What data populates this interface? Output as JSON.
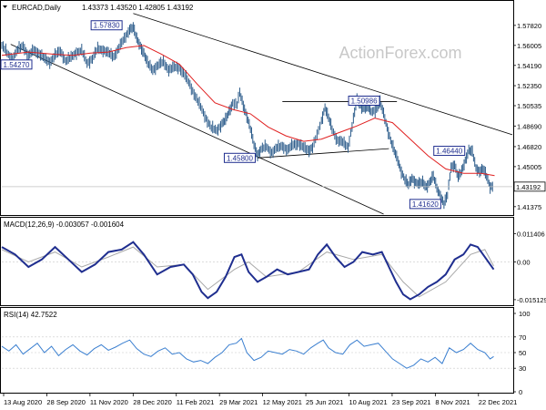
{
  "header": {
    "symbol": "EURCAD,Daily",
    "ohlc": "1.43373 1.43520 1.42805 1.43192"
  },
  "watermark": "ActionForex.com",
  "colors": {
    "price": "#2b5b8a",
    "ma": "#e02020",
    "channel": "#000000",
    "macd": "#1f2e8f",
    "signal": "#a8a8a8",
    "rsi": "#3a7fd0",
    "label": "#1f2e8f"
  },
  "chart_data": [
    {
      "type": "line",
      "title": "EURCAD,Daily",
      "ylim": [
        1.407,
        1.588
      ],
      "y_ticks": [
        "1.57820",
        "1.56005",
        "1.54190",
        "1.52350",
        "1.50535",
        "1.48690",
        "1.46820",
        "1.45005",
        "1.43192",
        "1.41375"
      ],
      "x_ticks": [
        "13 Aug 2020",
        "28 Sep 2020",
        "11 Nov 2020",
        "28 Dec 2020",
        "11 Feb 2021",
        "29 Mar 2021",
        "12 May 2021",
        "25 Jun 2021",
        "10 Aug 2021",
        "23 Sep 2021",
        "8 Nov 2021",
        "22 Dec 2021"
      ],
      "current_price": "1.43192",
      "price_path": [
        [
          0,
          1.56
        ],
        [
          6,
          1.553
        ],
        [
          12,
          1.548
        ],
        [
          18,
          1.556
        ],
        [
          24,
          1.56
        ],
        [
          30,
          1.55
        ],
        [
          36,
          1.556
        ],
        [
          42,
          1.553
        ],
        [
          48,
          1.548
        ],
        [
          54,
          1.545
        ],
        [
          60,
          1.551
        ],
        [
          66,
          1.555
        ],
        [
          72,
          1.546
        ],
        [
          78,
          1.549
        ],
        [
          84,
          1.554
        ],
        [
          90,
          1.555
        ],
        [
          96,
          1.544
        ],
        [
          102,
          1.548
        ],
        [
          108,
          1.557
        ],
        [
          114,
          1.556
        ],
        [
          120,
          1.553
        ],
        [
          126,
          1.55
        ],
        [
          132,
          1.558
        ],
        [
          138,
          1.566
        ],
        [
          144,
          1.575
        ],
        [
          148,
          1.576
        ],
        [
          152,
          1.566
        ],
        [
          156,
          1.56
        ],
        [
          160,
          1.553
        ],
        [
          164,
          1.544
        ],
        [
          170,
          1.538
        ],
        [
          176,
          1.542
        ],
        [
          182,
          1.545
        ],
        [
          188,
          1.538
        ],
        [
          194,
          1.54
        ],
        [
          200,
          1.54
        ],
        [
          206,
          1.533
        ],
        [
          212,
          1.524
        ],
        [
          218,
          1.514
        ],
        [
          224,
          1.504
        ],
        [
          230,
          1.494
        ],
        [
          236,
          1.485
        ],
        [
          242,
          1.483
        ],
        [
          248,
          1.489
        ],
        [
          252,
          1.492
        ],
        [
          256,
          1.5
        ],
        [
          260,
          1.508
        ],
        [
          265,
          1.506
        ],
        [
          268,
          1.517
        ],
        [
          272,
          1.506
        ],
        [
          276,
          1.496
        ],
        [
          280,
          1.484
        ],
        [
          284,
          1.47
        ],
        [
          288,
          1.461
        ],
        [
          292,
          1.466
        ],
        [
          298,
          1.468
        ],
        [
          304,
          1.463
        ],
        [
          310,
          1.467
        ],
        [
          316,
          1.469
        ],
        [
          322,
          1.465
        ],
        [
          328,
          1.47
        ],
        [
          334,
          1.471
        ],
        [
          340,
          1.467
        ],
        [
          346,
          1.465
        ],
        [
          350,
          1.468
        ],
        [
          355,
          1.478
        ],
        [
          360,
          1.492
        ],
        [
          364,
          1.504
        ],
        [
          368,
          1.494
        ],
        [
          372,
          1.484
        ],
        [
          378,
          1.474
        ],
        [
          384,
          1.472
        ],
        [
          390,
          1.468
        ],
        [
          396,
          1.493
        ],
        [
          400,
          1.51
        ],
        [
          404,
          1.506
        ],
        [
          408,
          1.503
        ],
        [
          412,
          1.504
        ],
        [
          416,
          1.5
        ],
        [
          422,
          1.502
        ],
        [
          426,
          1.508
        ],
        [
          430,
          1.498
        ],
        [
          434,
          1.486
        ],
        [
          438,
          1.474
        ],
        [
          442,
          1.464
        ],
        [
          446,
          1.456
        ],
        [
          450,
          1.446
        ],
        [
          454,
          1.438
        ],
        [
          458,
          1.433
        ],
        [
          462,
          1.44
        ],
        [
          466,
          1.436
        ],
        [
          470,
          1.434
        ],
        [
          474,
          1.436
        ],
        [
          478,
          1.432
        ],
        [
          482,
          1.436
        ],
        [
          486,
          1.441
        ],
        [
          490,
          1.431
        ],
        [
          494,
          1.424
        ],
        [
          498,
          1.416
        ],
        [
          502,
          1.424
        ],
        [
          506,
          1.45
        ],
        [
          510,
          1.452
        ],
        [
          514,
          1.44
        ],
        [
          518,
          1.446
        ],
        [
          522,
          1.456
        ],
        [
          526,
          1.465
        ],
        [
          530,
          1.463
        ],
        [
          534,
          1.449
        ],
        [
          538,
          1.446
        ],
        [
          542,
          1.448
        ],
        [
          546,
          1.441
        ],
        [
          550,
          1.432
        ],
        [
          554,
          1.433
        ]
      ],
      "ma_path": [
        [
          0,
          1.551
        ],
        [
          30,
          1.554
        ],
        [
          60,
          1.552
        ],
        [
          80,
          1.551
        ],
        [
          100,
          1.553
        ],
        [
          120,
          1.554
        ],
        [
          140,
          1.558
        ],
        [
          160,
          1.56
        ],
        [
          180,
          1.552
        ],
        [
          200,
          1.543
        ],
        [
          220,
          1.525
        ],
        [
          240,
          1.508
        ],
        [
          260,
          1.502
        ],
        [
          280,
          1.498
        ],
        [
          300,
          1.486
        ],
        [
          320,
          1.478
        ],
        [
          340,
          1.473
        ],
        [
          360,
          1.475
        ],
        [
          380,
          1.481
        ],
        [
          400,
          1.487
        ],
        [
          420,
          1.494
        ],
        [
          440,
          1.49
        ],
        [
          460,
          1.475
        ],
        [
          480,
          1.46
        ],
        [
          500,
          1.448
        ],
        [
          520,
          1.444
        ],
        [
          540,
          1.444
        ],
        [
          555,
          1.442
        ]
      ],
      "channel_lines": [
        {
          "from": [
            148,
            1.589
          ],
          "to": [
            575,
            1.479
          ]
        },
        {
          "from": [
            10,
            1.561
          ],
          "to": [
            430,
            1.407
          ]
        },
        {
          "from": [
            288,
            1.458
          ],
          "to": [
            436,
            1.4664
          ]
        },
        {
          "from": [
            316,
            1.509
          ],
          "to": [
            445,
            1.509
          ]
        }
      ],
      "annotations": [
        {
          "text": "1.57830",
          "x": 118,
          "y": 1.5783
        },
        {
          "text": "1.45800",
          "x": 268,
          "y": 1.458
        },
        {
          "text": "1.50986",
          "x": 408,
          "y": 1.5099
        },
        {
          "text": "1.46440",
          "x": 504,
          "y": 1.4644
        },
        {
          "text": "1.41620",
          "x": 477,
          "y": 1.4162
        },
        {
          "text": "1.54270",
          "x": 8,
          "y": 1.5427
        }
      ]
    },
    {
      "type": "line",
      "title": "MACD(12,26,9) -0.003057 -0.001604",
      "ylim": [
        -0.017,
        0.013
      ],
      "y_ticks": [
        "0.011406",
        "0.00",
        "-0.015129"
      ],
      "series": [
        {
          "name": "MACD",
          "values": [
            [
              0,
              0.006
            ],
            [
              15,
              0.003
            ],
            [
              30,
              -0.002
            ],
            [
              45,
              0.001
            ],
            [
              60,
              0.006
            ],
            [
              75,
              0.001
            ],
            [
              90,
              -0.004
            ],
            [
              105,
              -0.001
            ],
            [
              120,
              0.004
            ],
            [
              135,
              0.005
            ],
            [
              148,
              0.008
            ],
            [
              160,
              0.003
            ],
            [
              175,
              -0.005
            ],
            [
              190,
              -0.002
            ],
            [
              205,
              -0.001
            ],
            [
              215,
              -0.005
            ],
            [
              225,
              -0.012
            ],
            [
              232,
              -0.0145
            ],
            [
              242,
              -0.012
            ],
            [
              252,
              -0.006
            ],
            [
              262,
              0.002
            ],
            [
              270,
              0.003
            ],
            [
              278,
              -0.004
            ],
            [
              288,
              -0.008
            ],
            [
              298,
              -0.006
            ],
            [
              310,
              -0.003
            ],
            [
              322,
              -0.005
            ],
            [
              334,
              -0.004
            ],
            [
              346,
              -0.003
            ],
            [
              356,
              0.003
            ],
            [
              366,
              0.007
            ],
            [
              376,
              0.002
            ],
            [
              386,
              -0.002
            ],
            [
              396,
              0.0
            ],
            [
              406,
              0.004
            ],
            [
              418,
              0.003
            ],
            [
              428,
              0.004
            ],
            [
              436,
              -0.002
            ],
            [
              444,
              -0.008
            ],
            [
              452,
              -0.013
            ],
            [
              460,
              -0.015
            ],
            [
              470,
              -0.013
            ],
            [
              480,
              -0.01
            ],
            [
              490,
              -0.008
            ],
            [
              500,
              -0.005
            ],
            [
              510,
              0.001
            ],
            [
              520,
              0.003
            ],
            [
              528,
              0.007
            ],
            [
              536,
              0.006
            ],
            [
              544,
              0.002
            ],
            [
              554,
              -0.003
            ]
          ]
        },
        {
          "name": "Signal",
          "values": [
            [
              0,
              0.005
            ],
            [
              30,
              0.0
            ],
            [
              60,
              0.004
            ],
            [
              90,
              -0.002
            ],
            [
              120,
              0.002
            ],
            [
              148,
              0.006
            ],
            [
              175,
              -0.002
            ],
            [
              205,
              -0.001
            ],
            [
              232,
              -0.011
            ],
            [
              262,
              -0.003
            ],
            [
              278,
              0.0
            ],
            [
              298,
              -0.006
            ],
            [
              334,
              -0.004
            ],
            [
              366,
              0.004
            ],
            [
              396,
              0.001
            ],
            [
              428,
              0.003
            ],
            [
              452,
              -0.008
            ],
            [
              470,
              -0.014
            ],
            [
              500,
              -0.008
            ],
            [
              528,
              0.003
            ],
            [
              544,
              0.005
            ],
            [
              554,
              -0.0016
            ]
          ]
        }
      ]
    },
    {
      "type": "line",
      "title": "RSI(14) 42.7522",
      "ylim": [
        0,
        100
      ],
      "y_ticks": [
        "100",
        "70",
        "50",
        "30",
        "0"
      ],
      "values": [
        [
          0,
          58
        ],
        [
          8,
          52
        ],
        [
          16,
          60
        ],
        [
          24,
          48
        ],
        [
          32,
          55
        ],
        [
          40,
          62
        ],
        [
          48,
          50
        ],
        [
          56,
          58
        ],
        [
          64,
          46
        ],
        [
          72,
          54
        ],
        [
          80,
          60
        ],
        [
          88,
          52
        ],
        [
          96,
          47
        ],
        [
          104,
          55
        ],
        [
          112,
          60
        ],
        [
          120,
          53
        ],
        [
          128,
          57
        ],
        [
          136,
          62
        ],
        [
          144,
          66
        ],
        [
          152,
          55
        ],
        [
          160,
          48
        ],
        [
          168,
          45
        ],
        [
          176,
          52
        ],
        [
          184,
          56
        ],
        [
          192,
          48
        ],
        [
          200,
          50
        ],
        [
          208,
          42
        ],
        [
          216,
          38
        ],
        [
          224,
          40
        ],
        [
          232,
          36
        ],
        [
          240,
          44
        ],
        [
          248,
          50
        ],
        [
          256,
          60
        ],
        [
          264,
          62
        ],
        [
          270,
          68
        ],
        [
          276,
          50
        ],
        [
          284,
          40
        ],
        [
          292,
          44
        ],
        [
          300,
          52
        ],
        [
          308,
          50
        ],
        [
          316,
          48
        ],
        [
          324,
          54
        ],
        [
          332,
          52
        ],
        [
          340,
          48
        ],
        [
          348,
          56
        ],
        [
          356,
          62
        ],
        [
          362,
          66
        ],
        [
          368,
          56
        ],
        [
          376,
          50
        ],
        [
          384,
          48
        ],
        [
          392,
          60
        ],
        [
          400,
          66
        ],
        [
          408,
          58
        ],
        [
          416,
          60
        ],
        [
          424,
          62
        ],
        [
          432,
          52
        ],
        [
          440,
          42
        ],
        [
          448,
          36
        ],
        [
          456,
          30
        ],
        [
          464,
          34
        ],
        [
          472,
          42
        ],
        [
          480,
          38
        ],
        [
          488,
          44
        ],
        [
          496,
          36
        ],
        [
          504,
          56
        ],
        [
          512,
          50
        ],
        [
          520,
          54
        ],
        [
          528,
          62
        ],
        [
          536,
          54
        ],
        [
          544,
          50
        ],
        [
          550,
          42
        ],
        [
          554,
          45
        ]
      ]
    }
  ]
}
